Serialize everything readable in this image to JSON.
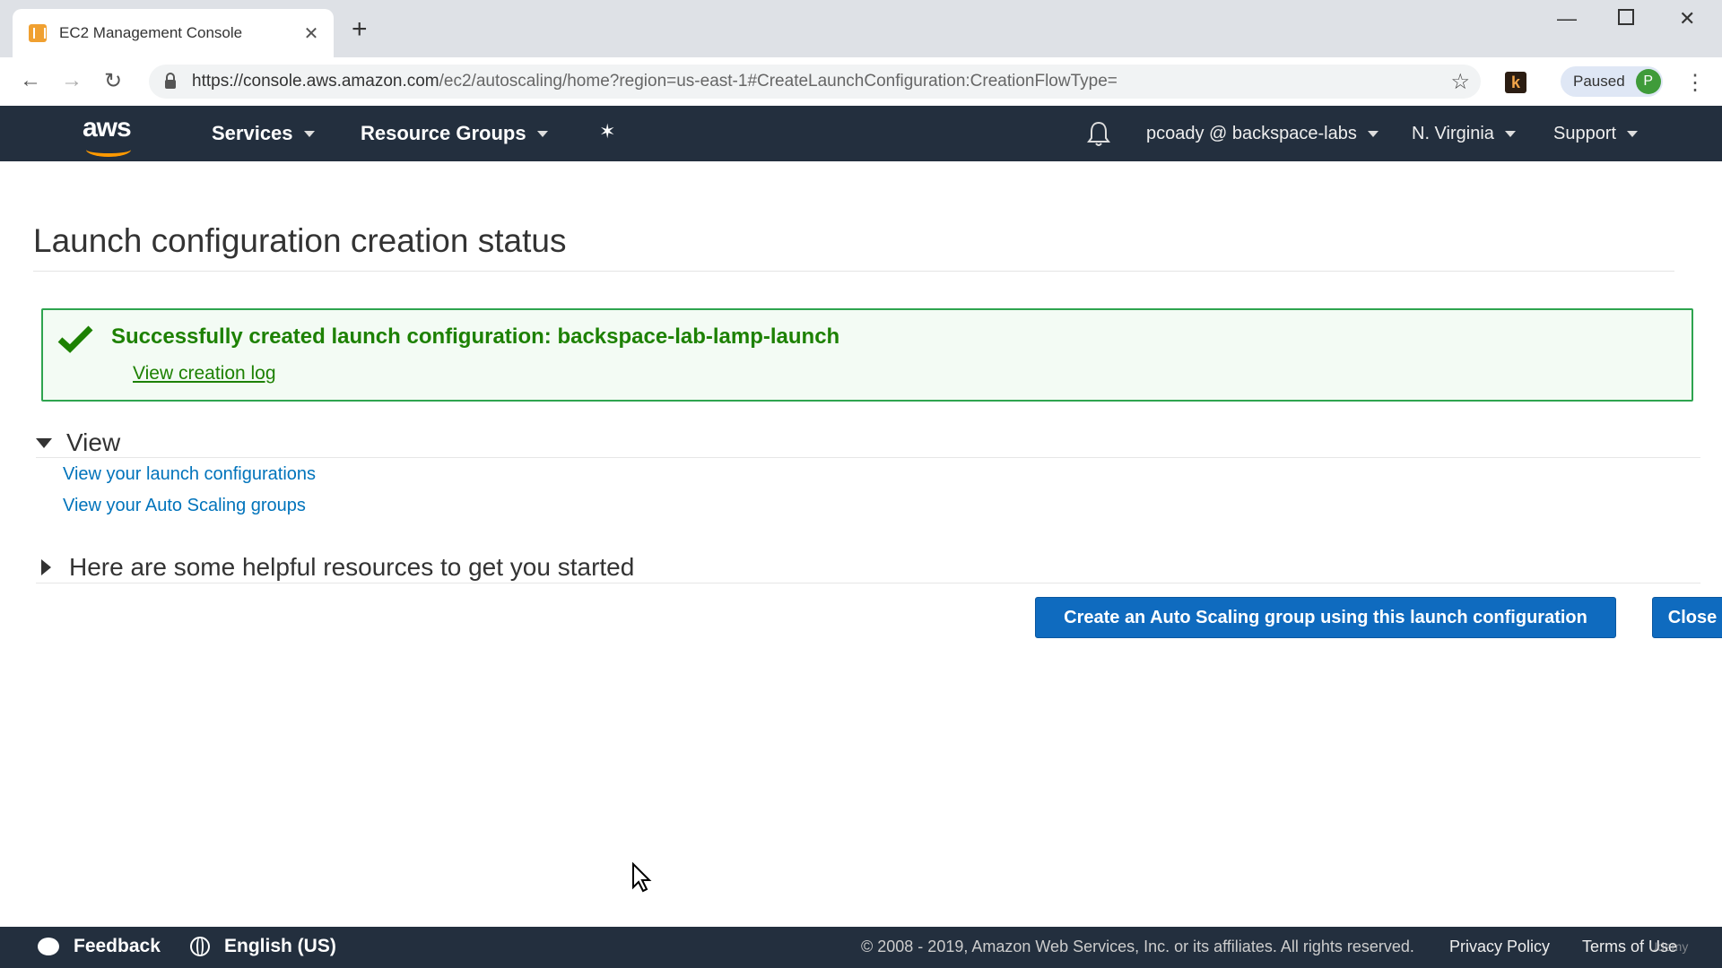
{
  "browser": {
    "tab_title": "EC2 Management Console",
    "tab_close": "✕",
    "new_tab": "+",
    "url_main": "https://console.aws.amazon.com",
    "url_path": "/ec2/autoscaling/home?region=us-east-1#CreateLaunchConfiguration:CreationFlowType=",
    "extension_letter": "k",
    "profile_status": "Paused",
    "profile_initial": "P"
  },
  "aws_nav": {
    "logo_text": "aws",
    "services": "Services",
    "resource_groups": "Resource Groups",
    "account": "pcoady @ backspace-labs",
    "region": "N. Virginia",
    "support": "Support"
  },
  "page": {
    "title": "Launch configuration creation status",
    "success_message": "Successfully created launch configuration: backspace-lab-lamp-launch",
    "view_log": "View creation log",
    "view_section": "View",
    "links": [
      "View your launch configurations",
      "View your Auto Scaling groups"
    ],
    "resources_section": "Here are some helpful resources to get you started",
    "create_button": "Create an Auto Scaling group using this launch configuration",
    "close_button": "Close"
  },
  "footer": {
    "feedback": "Feedback",
    "language": "English (US)",
    "copyright": "© 2008 - 2019, Amazon Web Services, Inc. or its affiliates. All rights reserved.",
    "privacy": "Privacy Policy",
    "terms": "Terms of Use",
    "watermark": "Udemy"
  },
  "colors": {
    "aws_nav_bg": "#232f3e",
    "success_green": "#1d8102",
    "link_blue": "#0073bb",
    "button_blue": "#0f6bbf"
  }
}
